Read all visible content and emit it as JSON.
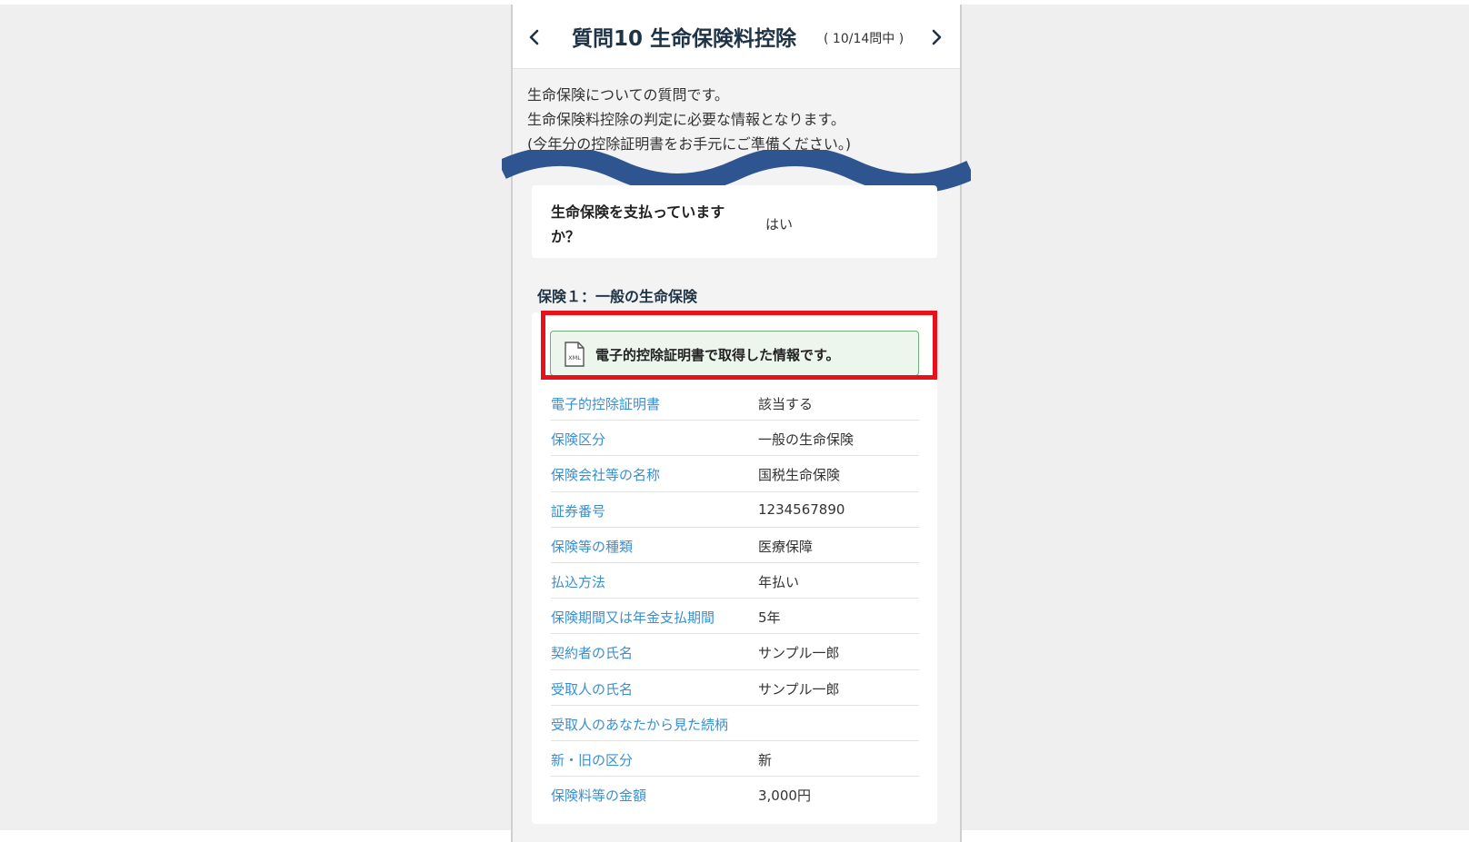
{
  "header": {
    "title": "質問10 生命保険料控除",
    "count": "( 10/14問中 )",
    "prev_icon": "chevron-left-icon",
    "next_icon": "chevron-right-icon"
  },
  "intro": {
    "lines": [
      "生命保険についての質問です。",
      "生命保険料控除の判定に必要な情報となります。",
      "(今年分の控除証明書をお手元にご準備ください。)"
    ]
  },
  "question": {
    "label": "生命保険を支払っていますか？",
    "answer": "はい"
  },
  "section": {
    "title": "保険１：一般の生命保険"
  },
  "notice": {
    "icon": "xml-file-icon",
    "icon_text": "XML",
    "text": "電子的控除証明書で取得した情報です。"
  },
  "rows": [
    {
      "label": "電子的控除証明書",
      "value": "該当する"
    },
    {
      "label": "保険区分",
      "value": "一般の生命保険"
    },
    {
      "label": "保険会社等の名称",
      "value": "国税生命保険"
    },
    {
      "label": "証券番号",
      "value": "1234567890"
    },
    {
      "label": "保険等の種類",
      "value": "医療保障"
    },
    {
      "label": "払込方法",
      "value": "年払い"
    },
    {
      "label": "保険期間又は年金支払期間",
      "value": "5年"
    },
    {
      "label": "契約者の氏名",
      "value": "サンプル一郎"
    },
    {
      "label": "受取人の氏名",
      "value": "サンプル一郎"
    },
    {
      "label": "受取人のあなたから見た続柄",
      "value": ""
    },
    {
      "label": "新・旧の区分",
      "value": "新"
    },
    {
      "label": "保険料等の金額",
      "value": "3,000円"
    }
  ],
  "colors": {
    "accent_blue": "#3a8fd0",
    "wave_blue": "#2f5590",
    "highlight_red": "#e8101a",
    "notice_green": "#edf6ed"
  }
}
